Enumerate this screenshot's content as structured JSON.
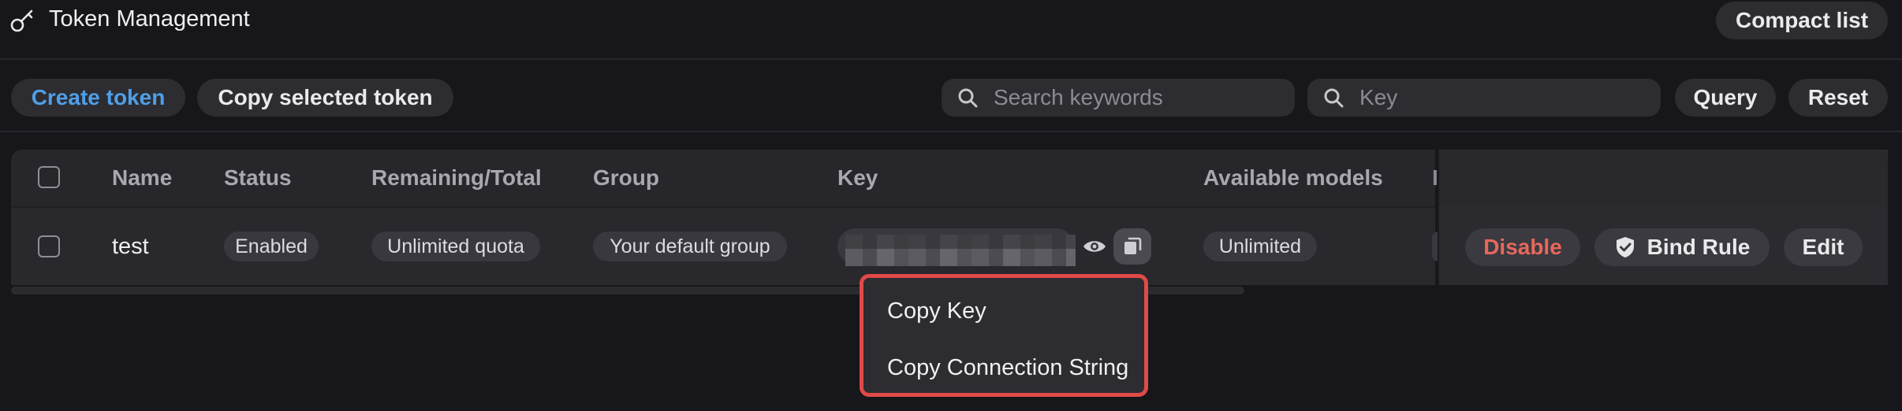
{
  "header": {
    "title": "Token Management",
    "compact_list_label": "Compact list"
  },
  "toolbar": {
    "create_token_label": "Create token",
    "copy_selected_label": "Copy selected token",
    "search_placeholder": "Search keywords",
    "key_placeholder": "Key",
    "query_label": "Query",
    "reset_label": "Reset"
  },
  "table": {
    "columns": [
      "Name",
      "Status",
      "Remaining/Total",
      "Group",
      "Key",
      "Available models",
      "I"
    ],
    "rows": [
      {
        "name": "test",
        "status": "Enabled",
        "remaining": "Unlimited quota",
        "group": "Your default group",
        "models": "Unlimited",
        "actions": {
          "disable": "Disable",
          "bind_rule": "Bind Rule",
          "edit": "Edit"
        }
      }
    ]
  },
  "copy_menu": {
    "items": [
      "Copy Key",
      "Copy Connection String"
    ]
  },
  "colors": {
    "accent": "#4f9fe8",
    "danger": "#e8675c",
    "highlight_border": "#e04a48"
  }
}
